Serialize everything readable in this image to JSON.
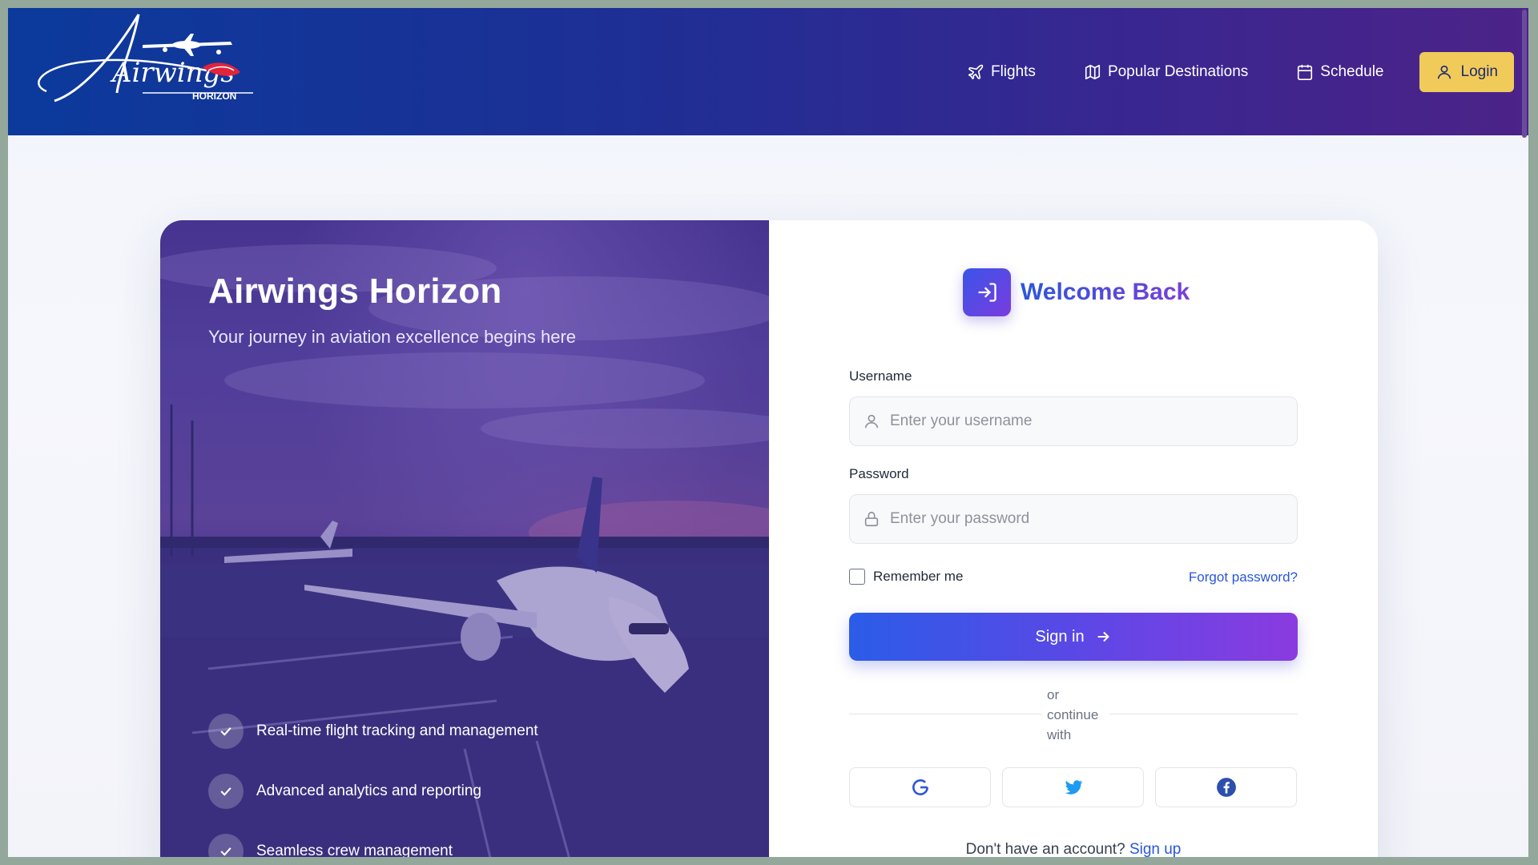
{
  "header": {
    "logo_text": "Airwings",
    "logo_subtext": "HORIZON",
    "nav": [
      {
        "label": "Flights",
        "icon": "plane-icon"
      },
      {
        "label": "Popular Destinations",
        "icon": "map-icon"
      },
      {
        "label": "Schedule",
        "icon": "calendar-icon"
      }
    ],
    "login_label": "Login"
  },
  "hero": {
    "title": "Airwings Horizon",
    "subtitle": "Your journey in aviation excellence begins here",
    "features": [
      "Real-time flight tracking and management",
      "Advanced analytics and reporting",
      "Seamless crew management"
    ]
  },
  "form": {
    "heading": "Welcome Back",
    "username_label": "Username",
    "username_placeholder": "Enter your username",
    "password_label": "Password",
    "password_placeholder": "Enter your password",
    "remember_label": "Remember me",
    "forgot_label": "Forgot password?",
    "signin_label": "Sign in",
    "divider_text": "or continue with",
    "socials": [
      "google-icon",
      "twitter-icon",
      "facebook-icon"
    ],
    "signup_prompt": "Don't have an account?",
    "signup_label": "Sign up"
  },
  "colors": {
    "header_start": "#0b3a9c",
    "header_end": "#4c2388",
    "login_button": "#f1cb5a",
    "accent_blue": "#2856d8",
    "accent_purple": "#8a3be0"
  }
}
